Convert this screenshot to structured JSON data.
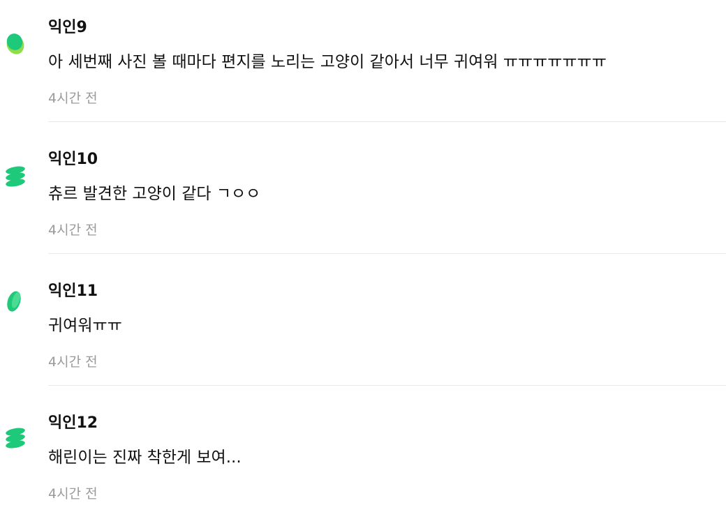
{
  "colors": {
    "accent_green": "#1ec97a",
    "accent_light_green": "#8fdd4a",
    "time_gray": "#9a9a9a",
    "divider": "#e8e8e8"
  },
  "comments": [
    {
      "author": "익인9",
      "text": "아 세번째 사진 볼 때마다 편지를 노리는 고양이 같아서 너무 귀여워 ㅠㅠㅠㅠㅠㅠㅠ",
      "time": "4시간 전",
      "avatar_icon": "green-blob-icon"
    },
    {
      "author": "익인10",
      "text": "츄르 발견한 고양이 같다 ㄱㅇㅇ",
      "time": "4시간 전",
      "avatar_icon": "green-stack-icon"
    },
    {
      "author": "익인11",
      "text": "귀여워ㅠㅠ",
      "time": "4시간 전",
      "avatar_icon": "green-leaf-icon"
    },
    {
      "author": "익인12",
      "text": "해린이는 진짜 착한게 보여...",
      "time": "4시간 전",
      "avatar_icon": "green-stack-icon"
    }
  ]
}
